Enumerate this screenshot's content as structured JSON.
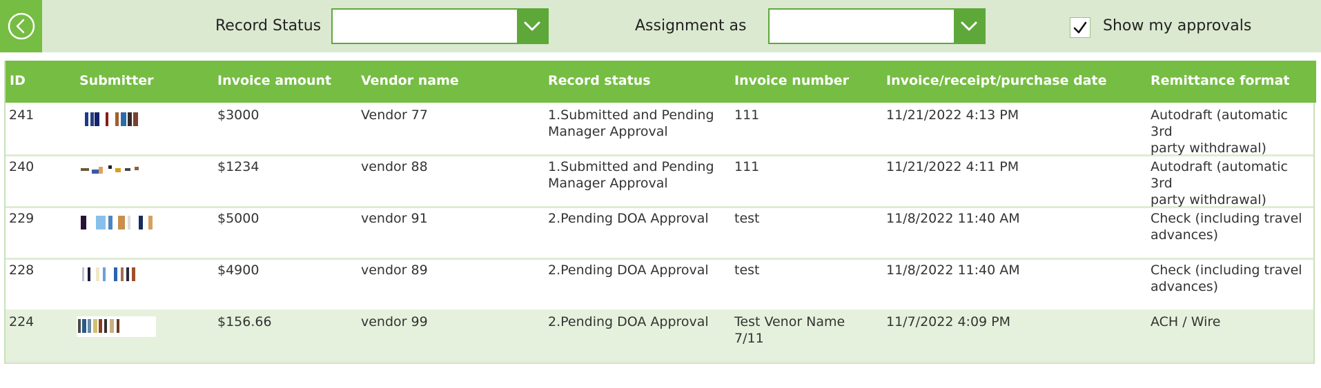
{
  "filters": {
    "record_status_label": "Record Status",
    "record_status_value": "",
    "assignment_label": "Assignment as",
    "assignment_value": "",
    "show_approvals_label": "Show my approvals",
    "show_approvals_checked": true
  },
  "table": {
    "headers": [
      "ID",
      "Submitter",
      "Invoice amount",
      "Vendor name",
      "Record status",
      "Invoice number",
      "Invoice/receipt/purchase date",
      "Remittance format"
    ],
    "rows": [
      {
        "id": "241",
        "amount": "$3000",
        "vendor": "Vendor 77",
        "status_line1": "1.Submitted and Pending",
        "status_line2": "Manager Approval",
        "invoice_line1": "111",
        "invoice_line2": "",
        "date": "11/21/2022 4:13 PM",
        "remit_line1": "Autodraft (automatic 3rd",
        "remit_line2": "party withdrawal)"
      },
      {
        "id": "240",
        "amount": "$1234",
        "vendor": "vendor 88",
        "status_line1": "1.Submitted and Pending",
        "status_line2": "Manager Approval",
        "invoice_line1": "111",
        "invoice_line2": "",
        "date": "11/21/2022 4:11 PM",
        "remit_line1": "Autodraft (automatic 3rd",
        "remit_line2": "party withdrawal)"
      },
      {
        "id": "229",
        "amount": "$5000",
        "vendor": "vendor 91",
        "status_line1": "2.Pending DOA Approval",
        "status_line2": "",
        "invoice_line1": "test",
        "invoice_line2": "",
        "date": "11/8/2022 11:40 AM",
        "remit_line1": "Check (including travel",
        "remit_line2": "advances)"
      },
      {
        "id": "228",
        "amount": "$4900",
        "vendor": "vendor 89",
        "status_line1": "2.Pending DOA Approval",
        "status_line2": "",
        "invoice_line1": "test",
        "invoice_line2": "",
        "date": "11/8/2022 11:40 AM",
        "remit_line1": "Check (including travel",
        "remit_line2": "advances)"
      },
      {
        "id": "224",
        "amount": "$156.66",
        "vendor": "vendor 99",
        "status_line1": "2.Pending DOA Approval",
        "status_line2": "",
        "invoice_line1": "Test Venor Name",
        "invoice_line2": "7/11",
        "date": "11/7/2022 4:09 PM",
        "remit_line1": "ACH / Wire",
        "remit_line2": ""
      }
    ],
    "selected_row_index": 4
  },
  "colors": {
    "accent": "#76bd43",
    "accent_dark": "#5ea83a",
    "filterbar_bg": "#dbe9d0",
    "row_selected_bg": "#e5f1dc",
    "row_divider": "#dfecd4"
  },
  "icons": {
    "back": "back-arrow-circle-icon",
    "dropdown": "chevron-down-icon",
    "checkbox": "checkmark-icon",
    "submitter": "redacted-avatar"
  }
}
